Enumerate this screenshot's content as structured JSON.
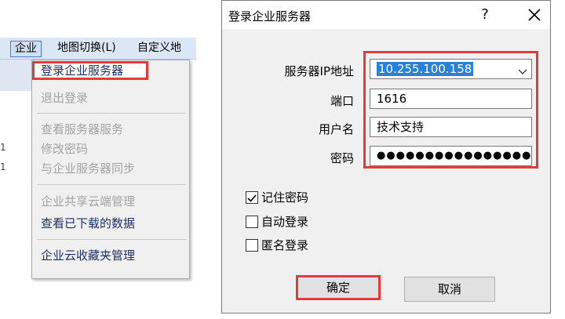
{
  "menubar": {
    "items": [
      {
        "label": "企业"
      },
      {
        "label": "地图切换(L)"
      },
      {
        "label": "自定义地"
      }
    ]
  },
  "background_digits": [
    "1",
    "1"
  ],
  "menu": {
    "items": [
      {
        "label": "登录企业服务器",
        "enabled": true
      },
      {
        "label": "退出登录",
        "enabled": false
      },
      {
        "label": "查看服务器服务",
        "enabled": false
      },
      {
        "label": "修改密码",
        "enabled": false
      },
      {
        "label": "与企业服务器同步",
        "enabled": false
      },
      {
        "label": "企业共享云端管理",
        "enabled": false
      },
      {
        "label": "查看已下载的数据",
        "enabled": true
      },
      {
        "label": "企业云收藏夹管理",
        "enabled": true
      }
    ]
  },
  "dialog": {
    "title": "登录企业服务器",
    "help_glyph": "?",
    "fields": {
      "server": {
        "label": "服务器IP地址",
        "value": "10.255.100.158"
      },
      "port": {
        "label": "端口",
        "value": "1616"
      },
      "username": {
        "label": "用户名",
        "value": "技术支持"
      },
      "password": {
        "label": "密码",
        "value": "●●●●●●●●●●●●●●●●●"
      }
    },
    "checkboxes": [
      {
        "label": "记住密码",
        "checked": true
      },
      {
        "label": "自动登录",
        "checked": false
      },
      {
        "label": "匿名登录",
        "checked": false
      }
    ],
    "buttons": {
      "ok": "确定",
      "cancel": "取消"
    }
  },
  "colors": {
    "highlight_border": "#e23b3b",
    "selection": "#2a7fd6",
    "menubar_bg": "#dce7f5",
    "dialog_bg": "#f0f0f0"
  }
}
